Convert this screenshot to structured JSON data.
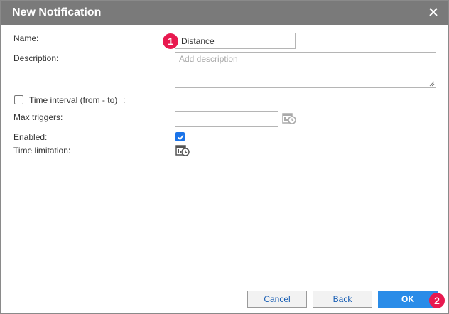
{
  "dialog": {
    "title": "New Notification",
    "close_icon": "close-icon"
  },
  "form": {
    "name_label": "Name:",
    "name_value": "Distance",
    "description_label": "Description:",
    "description_placeholder": "Add description",
    "time_interval_label": "Time interval (from - to)",
    "time_interval_suffix": ":",
    "time_interval_checked": false,
    "max_triggers_label": "Max triggers:",
    "max_triggers_value": "",
    "enabled_label": "Enabled:",
    "enabled_checked": true,
    "time_limitation_label": "Time limitation:",
    "calendar_icon": "calendar-clock-icon"
  },
  "badges": {
    "first": "1",
    "second": "2"
  },
  "buttons": {
    "cancel": "Cancel",
    "back": "Back",
    "ok": "OK"
  },
  "colors": {
    "titlebar": "#7a7a7a",
    "primary": "#2a8ce8",
    "badge": "#e8194f",
    "checkbox_checked": "#1a73e8"
  }
}
